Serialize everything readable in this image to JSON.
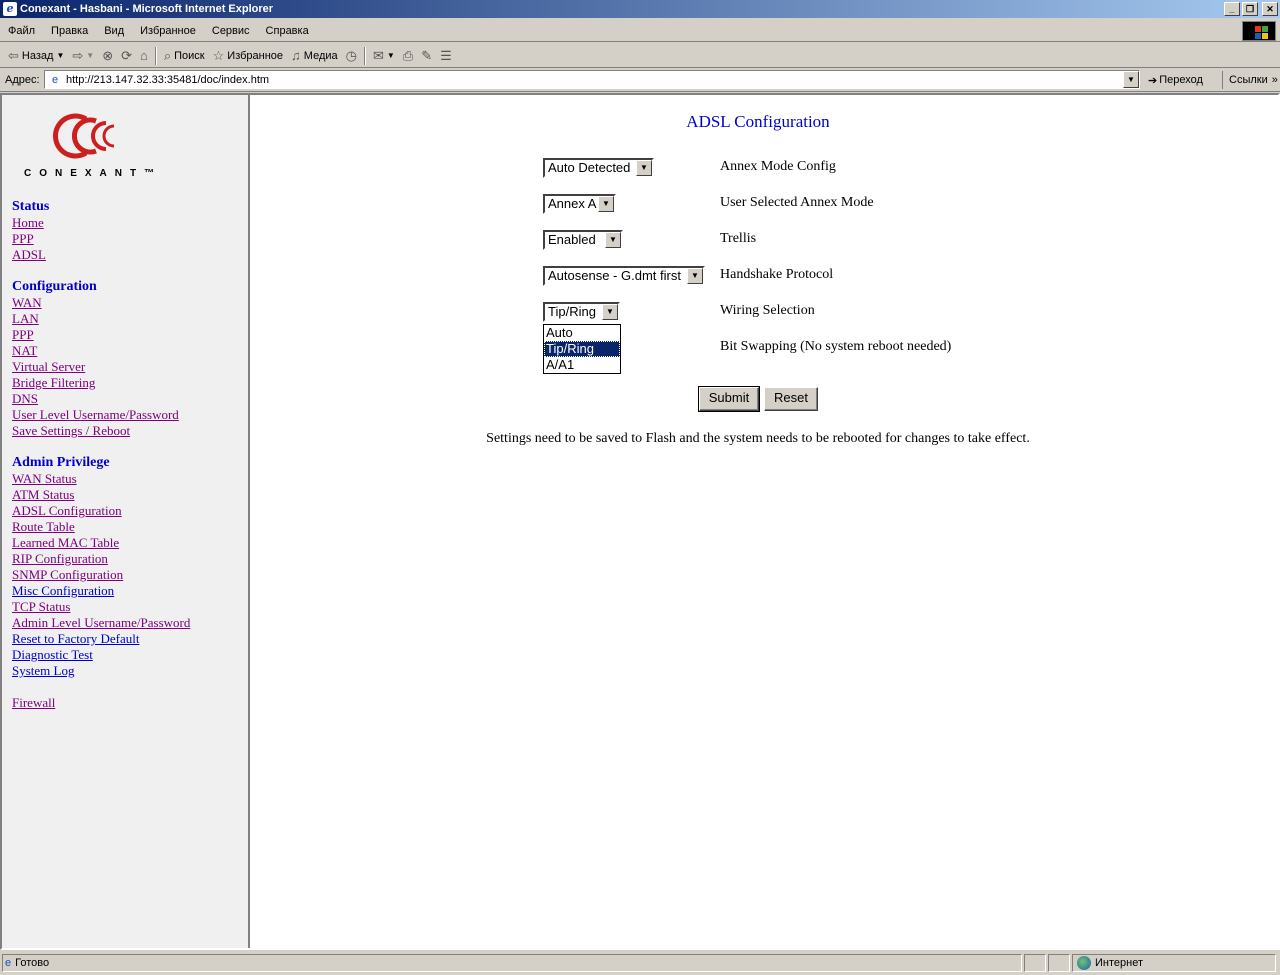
{
  "window": {
    "title": "Conexant - Hasbani - Microsoft Internet Explorer"
  },
  "menu": [
    "Файл",
    "Правка",
    "Вид",
    "Избранное",
    "Сервис",
    "Справка"
  ],
  "toolbar": {
    "back": "Назад",
    "search": "Поиск",
    "favorites": "Избранное",
    "media": "Медиа"
  },
  "address": {
    "label": "Адрес:",
    "url": "http://213.147.32.33:35481/doc/index.htm",
    "go": "Переход",
    "links": "Ссылки"
  },
  "logo": {
    "text": "CONEXANT™"
  },
  "nav": {
    "status_header": "Status",
    "status": [
      "Home",
      "PPP",
      "ADSL"
    ],
    "config_header": "Configuration",
    "config": [
      "WAN",
      "LAN",
      "PPP",
      "NAT",
      "Virtual Server",
      "Bridge Filtering",
      "DNS",
      "User Level Username/Password",
      "Save Settings / Reboot"
    ],
    "admin_header": "Admin Privilege",
    "admin": [
      "WAN Status",
      "ATM Status",
      "ADSL Configuration",
      "Route Table",
      "Learned MAC Table",
      "RIP Configuration",
      "SNMP Configuration",
      "Misc Configuration",
      "TCP Status",
      "Admin Level Username/Password",
      "Reset to Factory Default",
      "Diagnostic Test",
      "System Log"
    ],
    "firewall": "Firewall"
  },
  "page": {
    "title": "ADSL Configuration",
    "fields": [
      {
        "value": "Auto Detected",
        "label": "Annex Mode Config"
      },
      {
        "value": "Annex A",
        "label": "User Selected Annex Mode"
      },
      {
        "value": "Enabled",
        "label": "Trellis"
      },
      {
        "value": "Autosense - G.dmt first",
        "label": "Handshake Protocol"
      },
      {
        "value": "Tip/Ring",
        "label": "Wiring Selection"
      },
      {
        "value": "",
        "label": "Bit Swapping (No system reboot needed)"
      }
    ],
    "wiring_options": [
      "Auto",
      "Tip/Ring",
      "A/A1"
    ],
    "wiring_selected": "Tip/Ring",
    "submit": "Submit",
    "reset": "Reset",
    "note": "Settings need to be saved to Flash and the system needs to be rebooted for changes to take effect."
  },
  "status": {
    "text": "Готово",
    "zone": "Интернет"
  }
}
